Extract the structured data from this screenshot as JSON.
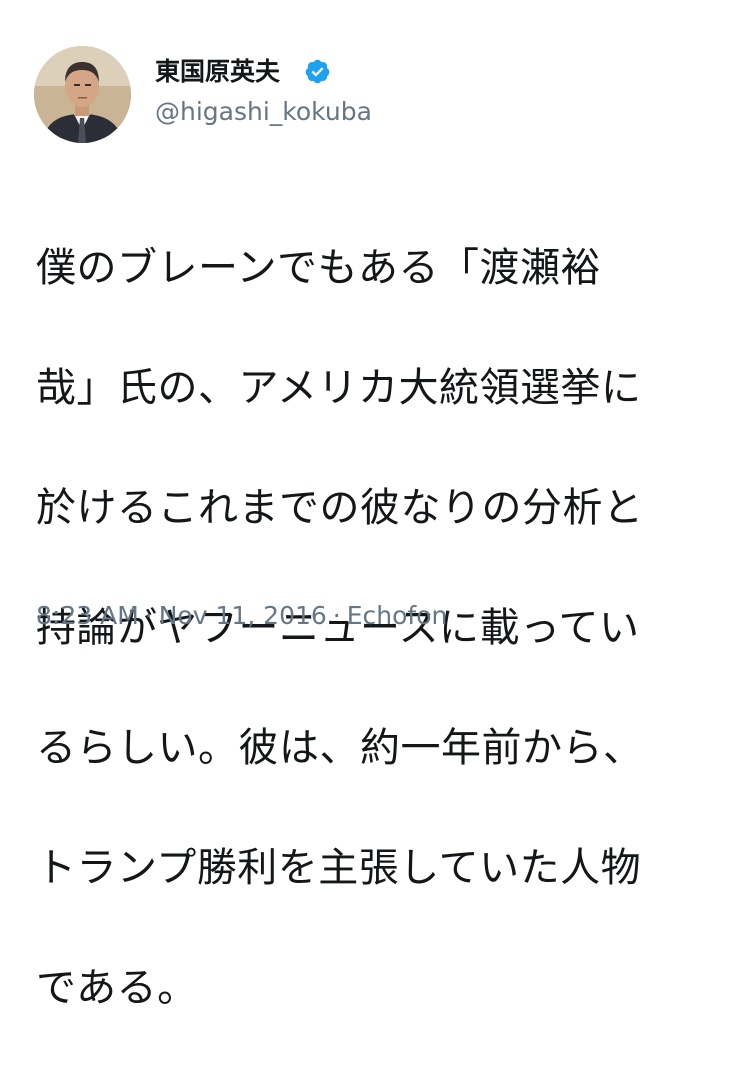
{
  "user": {
    "display_name": "東国原英夫",
    "handle": "@higashi_kokuba",
    "avatar_icon": "profile-photo",
    "verified_icon": "verified-badge-icon",
    "verified_color": "#1da1f2"
  },
  "tweet": {
    "text_lines": [
      "僕のブレーンでもある「渡瀬裕",
      "哉」氏の、アメリカ大統領選挙に",
      "於けるこれまでの彼なりの分析と",
      "持論がヤフーニュースに載ってい",
      "るらしい。彼は、約一年前から、",
      "トランプ勝利を主張していた人物",
      "である。"
    ]
  },
  "meta": {
    "time": "8:23 AM",
    "separator": "·",
    "date": "Nov 11, 2016",
    "client": "Echofon"
  },
  "colors": {
    "text": "#14171a",
    "secondary": "#657786",
    "background": "#ffffff"
  }
}
